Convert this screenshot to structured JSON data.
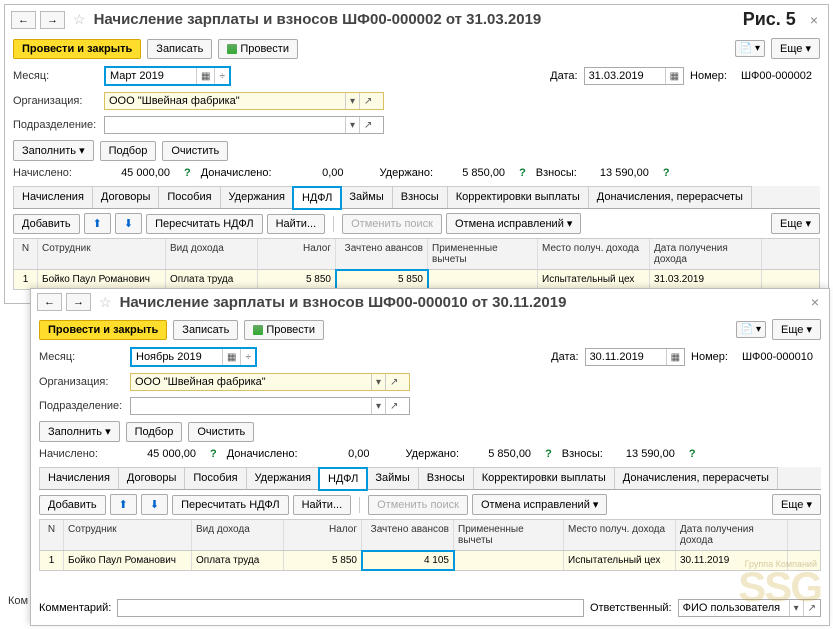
{
  "fig_label": "Рис. 5",
  "common": {
    "nav_back": "←",
    "nav_fwd": "→",
    "btn_post_close": "Провести и закрыть",
    "btn_save": "Записать",
    "btn_post": "Провести",
    "btn_more": "Еще",
    "lbl_month": "Месяц:",
    "lbl_date": "Дата:",
    "lbl_num": "Номер:",
    "lbl_org": "Организация:",
    "lbl_dept": "Подразделение:",
    "btn_fill": "Заполнить",
    "btn_pick": "Подбор",
    "btn_clear": "Очистить",
    "lbl_accrued": "Начислено:",
    "lbl_addl": "Доначислено:",
    "lbl_withheld": "Удержано:",
    "lbl_contrib": "Взносы:",
    "tabs": [
      "Начисления",
      "Договоры",
      "Пособия",
      "Удержания",
      "НДФЛ",
      "Займы",
      "Взносы",
      "Корректировки выплаты",
      "Доначисления, перерасчеты"
    ],
    "btn_add": "Добавить",
    "btn_recalc": "Пересчитать НДФЛ",
    "btn_find": "Найти...",
    "btn_cancel_find": "Отменить поиск",
    "btn_cancel_fix": "Отмена исправлений",
    "cols": {
      "n": "N",
      "emp": "Сотрудник",
      "vid": "Вид дохода",
      "nalog": "Налог",
      "zach": "Зачтено авансов",
      "vych": "Примененные вычеты",
      "mesto": "Место получ. дохода",
      "date": "Дата получения дохода"
    },
    "lbl_comment": "Комментарий:",
    "lbl_resp": "Ответственный:",
    "resp_val": "ФИО пользователя",
    "arrow_up": "⬆",
    "arrow_down": "⬇"
  },
  "w1": {
    "title": "Начисление зарплаты и взносов ШФ00-000002 от 31.03.2019",
    "month": "Март 2019",
    "date": "31.03.2019",
    "num": "ШФ00-000002",
    "org": "ООО \"Швейная фабрика\"",
    "accrued": "45 000,00",
    "addl": "0,00",
    "withheld": "5 850,00",
    "contrib": "13 590,00",
    "row": {
      "n": "1",
      "emp": "Бойко Паул Романович",
      "vid": "Оплата труда",
      "nalog": "5 850",
      "zach": "5 850",
      "mesto": "Испытательный цех",
      "date": "31.03.2019"
    }
  },
  "w2": {
    "title": "Начисление зарплаты и взносов ШФ00-000010 от 30.11.2019",
    "month": "Ноябрь 2019",
    "date": "30.11.2019",
    "num": "ШФ00-000010",
    "org": "ООО \"Швейная фабрика\"",
    "accrued": "45 000,00",
    "addl": "0,00",
    "withheld": "5 850,00",
    "contrib": "13 590,00",
    "row": {
      "n": "1",
      "emp": "Бойко Паул Романович",
      "vid": "Оплата труда",
      "nalog": "5 850",
      "zach": "4 105",
      "mesto": "Испытательный цех",
      "date": "30.11.2019"
    }
  },
  "watermark": "SSG",
  "watermark_sm": "Группа Компаний"
}
